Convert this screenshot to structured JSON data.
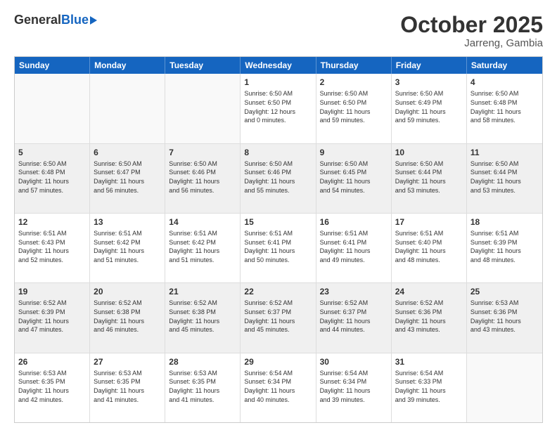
{
  "header": {
    "logo_general": "General",
    "logo_blue": "Blue",
    "month_title": "October 2025",
    "location": "Jarreng, Gambia"
  },
  "days_of_week": [
    "Sunday",
    "Monday",
    "Tuesday",
    "Wednesday",
    "Thursday",
    "Friday",
    "Saturday"
  ],
  "rows": [
    [
      {
        "day": "",
        "info": "",
        "empty": true
      },
      {
        "day": "",
        "info": "",
        "empty": true
      },
      {
        "day": "",
        "info": "",
        "empty": true
      },
      {
        "day": "1",
        "info": "Sunrise: 6:50 AM\nSunset: 6:50 PM\nDaylight: 12 hours\nand 0 minutes."
      },
      {
        "day": "2",
        "info": "Sunrise: 6:50 AM\nSunset: 6:50 PM\nDaylight: 11 hours\nand 59 minutes."
      },
      {
        "day": "3",
        "info": "Sunrise: 6:50 AM\nSunset: 6:49 PM\nDaylight: 11 hours\nand 59 minutes."
      },
      {
        "day": "4",
        "info": "Sunrise: 6:50 AM\nSunset: 6:48 PM\nDaylight: 11 hours\nand 58 minutes."
      }
    ],
    [
      {
        "day": "5",
        "info": "Sunrise: 6:50 AM\nSunset: 6:48 PM\nDaylight: 11 hours\nand 57 minutes.",
        "shaded": true
      },
      {
        "day": "6",
        "info": "Sunrise: 6:50 AM\nSunset: 6:47 PM\nDaylight: 11 hours\nand 56 minutes.",
        "shaded": true
      },
      {
        "day": "7",
        "info": "Sunrise: 6:50 AM\nSunset: 6:46 PM\nDaylight: 11 hours\nand 56 minutes.",
        "shaded": true
      },
      {
        "day": "8",
        "info": "Sunrise: 6:50 AM\nSunset: 6:46 PM\nDaylight: 11 hours\nand 55 minutes.",
        "shaded": true
      },
      {
        "day": "9",
        "info": "Sunrise: 6:50 AM\nSunset: 6:45 PM\nDaylight: 11 hours\nand 54 minutes.",
        "shaded": true
      },
      {
        "day": "10",
        "info": "Sunrise: 6:50 AM\nSunset: 6:44 PM\nDaylight: 11 hours\nand 53 minutes.",
        "shaded": true
      },
      {
        "day": "11",
        "info": "Sunrise: 6:50 AM\nSunset: 6:44 PM\nDaylight: 11 hours\nand 53 minutes.",
        "shaded": true
      }
    ],
    [
      {
        "day": "12",
        "info": "Sunrise: 6:51 AM\nSunset: 6:43 PM\nDaylight: 11 hours\nand 52 minutes."
      },
      {
        "day": "13",
        "info": "Sunrise: 6:51 AM\nSunset: 6:42 PM\nDaylight: 11 hours\nand 51 minutes."
      },
      {
        "day": "14",
        "info": "Sunrise: 6:51 AM\nSunset: 6:42 PM\nDaylight: 11 hours\nand 51 minutes."
      },
      {
        "day": "15",
        "info": "Sunrise: 6:51 AM\nSunset: 6:41 PM\nDaylight: 11 hours\nand 50 minutes."
      },
      {
        "day": "16",
        "info": "Sunrise: 6:51 AM\nSunset: 6:41 PM\nDaylight: 11 hours\nand 49 minutes."
      },
      {
        "day": "17",
        "info": "Sunrise: 6:51 AM\nSunset: 6:40 PM\nDaylight: 11 hours\nand 48 minutes."
      },
      {
        "day": "18",
        "info": "Sunrise: 6:51 AM\nSunset: 6:39 PM\nDaylight: 11 hours\nand 48 minutes."
      }
    ],
    [
      {
        "day": "19",
        "info": "Sunrise: 6:52 AM\nSunset: 6:39 PM\nDaylight: 11 hours\nand 47 minutes.",
        "shaded": true
      },
      {
        "day": "20",
        "info": "Sunrise: 6:52 AM\nSunset: 6:38 PM\nDaylight: 11 hours\nand 46 minutes.",
        "shaded": true
      },
      {
        "day": "21",
        "info": "Sunrise: 6:52 AM\nSunset: 6:38 PM\nDaylight: 11 hours\nand 45 minutes.",
        "shaded": true
      },
      {
        "day": "22",
        "info": "Sunrise: 6:52 AM\nSunset: 6:37 PM\nDaylight: 11 hours\nand 45 minutes.",
        "shaded": true
      },
      {
        "day": "23",
        "info": "Sunrise: 6:52 AM\nSunset: 6:37 PM\nDaylight: 11 hours\nand 44 minutes.",
        "shaded": true
      },
      {
        "day": "24",
        "info": "Sunrise: 6:52 AM\nSunset: 6:36 PM\nDaylight: 11 hours\nand 43 minutes.",
        "shaded": true
      },
      {
        "day": "25",
        "info": "Sunrise: 6:53 AM\nSunset: 6:36 PM\nDaylight: 11 hours\nand 43 minutes.",
        "shaded": true
      }
    ],
    [
      {
        "day": "26",
        "info": "Sunrise: 6:53 AM\nSunset: 6:35 PM\nDaylight: 11 hours\nand 42 minutes."
      },
      {
        "day": "27",
        "info": "Sunrise: 6:53 AM\nSunset: 6:35 PM\nDaylight: 11 hours\nand 41 minutes."
      },
      {
        "day": "28",
        "info": "Sunrise: 6:53 AM\nSunset: 6:35 PM\nDaylight: 11 hours\nand 41 minutes."
      },
      {
        "day": "29",
        "info": "Sunrise: 6:54 AM\nSunset: 6:34 PM\nDaylight: 11 hours\nand 40 minutes."
      },
      {
        "day": "30",
        "info": "Sunrise: 6:54 AM\nSunset: 6:34 PM\nDaylight: 11 hours\nand 39 minutes."
      },
      {
        "day": "31",
        "info": "Sunrise: 6:54 AM\nSunset: 6:33 PM\nDaylight: 11 hours\nand 39 minutes."
      },
      {
        "day": "",
        "info": "",
        "empty": true
      }
    ]
  ]
}
